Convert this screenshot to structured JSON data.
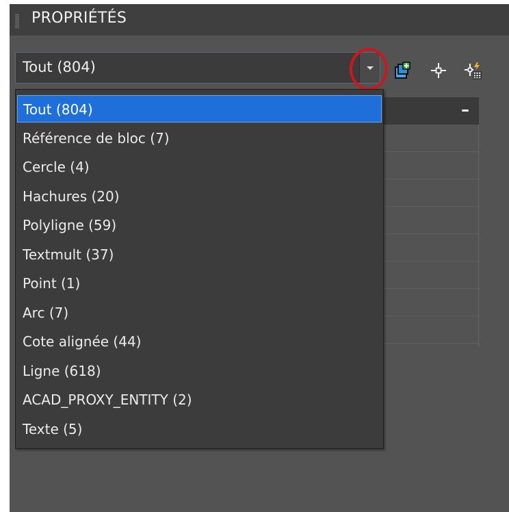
{
  "panel": {
    "title": "PROPRIÉTÉS"
  },
  "selector": {
    "value": "Tout (804)",
    "options": [
      "Tout (804)",
      "Référence de bloc (7)",
      "Cercle (4)",
      "Hachures (20)",
      "Polyligne (59)",
      "Textmult (37)",
      "Point (1)",
      "Arc (7)",
      "Cote alignée (44)",
      "Ligne (618)",
      "ACAD_PROXY_ENTITY (2)",
      "Texte (5)"
    ],
    "selected_index": 0
  },
  "toolbar": {
    "icons": [
      "toggle-pickadd-icon",
      "select-objects-icon",
      "quick-select-icon"
    ]
  },
  "property_grid": {
    "collapse_symbol": "–"
  },
  "colors": {
    "panel_bg": "#535353",
    "selection": "#1e6fd9",
    "annotation_ring": "#d0161c"
  }
}
